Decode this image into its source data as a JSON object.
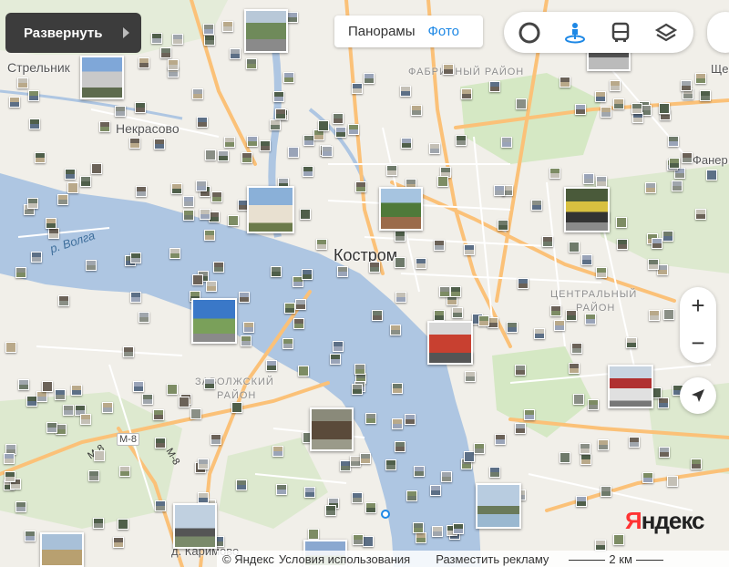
{
  "controls": {
    "expand_label": "Развернуть",
    "mode_panoramas": "Панорамы",
    "mode_photos": "Фото",
    "active_mode": "Фото",
    "zoom_in": "+",
    "zoom_out": "−"
  },
  "tools": [
    "traffic-ring-icon",
    "panorama-person-icon",
    "transit-bus-icon",
    "layers-icon"
  ],
  "map_labels": {
    "city": "Костром",
    "village_strelnik": "Стрельник",
    "village_nekrasovo": "Некрасово",
    "village_karimovo": "д. Каримово",
    "partial_right_top": "Ще",
    "partial_right_mid": "Фанер"
  },
  "districts": {
    "fabrichny": "ФАБРИЧНЫЙ РАЙОН",
    "central_1": "ЦЕНТРАЛЬНЫЙ",
    "central_2": "РАЙОН",
    "zavolzhsky_1": "ЗАВОЛЖСКИЙ",
    "zavolzhsky_2": "РАЙОН"
  },
  "river": "р. Волга",
  "roads": {
    "m8_badge": "М-8",
    "m8_a": "М-8",
    "m8_b": "М-8"
  },
  "logo": {
    "y": "Я",
    "rest": "ндекс"
  },
  "footer": {
    "copyright": "© Яндекс",
    "terms": "Условия использования",
    "advertise": "Разместить рекламу",
    "scale": "2 км"
  },
  "colors": {
    "water": "#aec6e2",
    "land": "#f1efe9",
    "park": "#d5e8c4",
    "major_road": "#fbc178",
    "minor_road": "#ffffff",
    "accent": "#1e88e5"
  }
}
